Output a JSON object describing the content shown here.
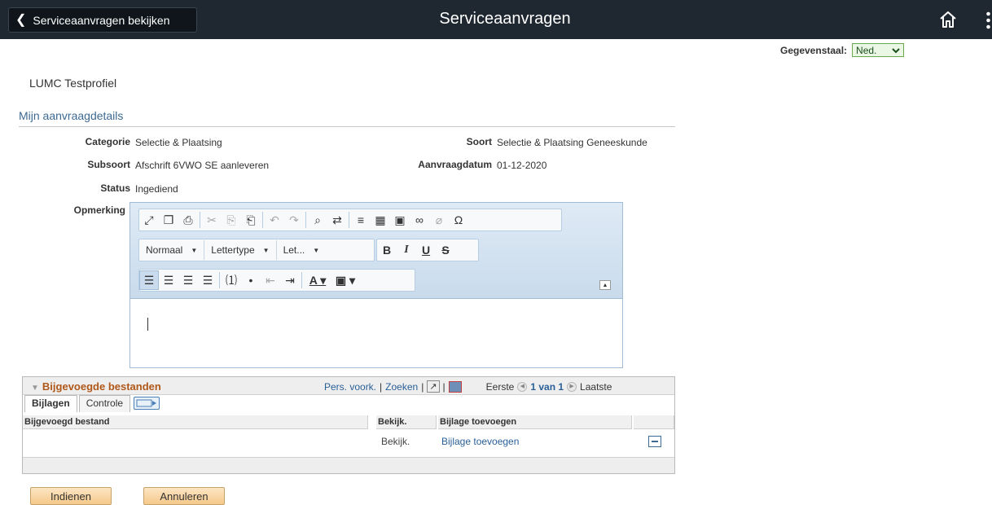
{
  "header": {
    "back_label": "Serviceaanvragen bekijken",
    "title": "Serviceaanvragen",
    "home_icon": "home-icon",
    "more_icon": "more-vertical-icon"
  },
  "language": {
    "label": "Gegevenstaal:",
    "value": "Ned."
  },
  "profile": "LUMC Testprofiel",
  "section_title": "Mijn aanvraagdetails",
  "details": {
    "categorie_label": "Categorie",
    "categorie_value": "Selectie & Plaatsing",
    "soort_label": "Soort",
    "soort_value": "Selectie & Plaatsing Geneeskunde",
    "subsoort_label": "Subsoort",
    "subsoort_value": "Afschrift 6VWO SE aanleveren",
    "datum_label": "Aanvraagdatum",
    "datum_value": "01-12-2020",
    "status_label": "Status",
    "status_value": "Ingediend",
    "opmerking_label": "Opmerking"
  },
  "editor": {
    "format_combo": "Normaal",
    "font_combo": "Lettertype",
    "size_combo": "Let...",
    "content": ""
  },
  "attachments": {
    "title": "Bijgevoegde bestanden",
    "personalize": "Pers. voork.",
    "search": "Zoeken",
    "first": "Eerste",
    "range": "1 van 1",
    "last": "Laatste",
    "tabs": [
      "Bijlagen",
      "Controle"
    ],
    "columns": [
      "Bijgevoegd bestand",
      "Bekijk.",
      "Bijlage toevoegen"
    ],
    "rows": [
      {
        "file": "",
        "view": "Bekijk.",
        "add": "Bijlage toevoegen"
      }
    ]
  },
  "buttons": {
    "submit": "Indienen",
    "cancel": "Annuleren"
  }
}
